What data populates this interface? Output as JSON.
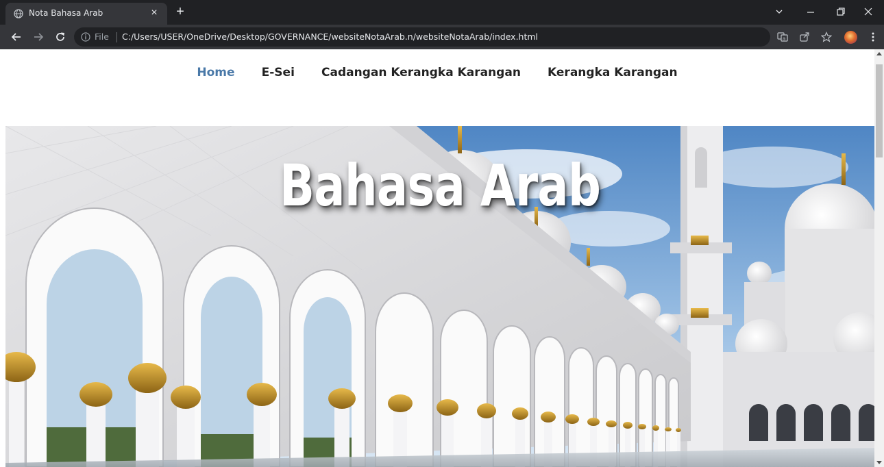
{
  "browser": {
    "tab_title": "Nota Bahasa Arab",
    "new_tab_symbol": "+",
    "close_symbol": "×",
    "file_label": "File",
    "url": "C:/Users/USER/OneDrive/Desktop/GOVERNANCE/websiteNotaArab.n/websiteNotaArab/index.html"
  },
  "nav": {
    "items": [
      {
        "label": "Home",
        "active": true
      },
      {
        "label": "E-Sei",
        "active": false
      },
      {
        "label": "Cadangan Kerangka Karangan",
        "active": false
      },
      {
        "label": "Kerangka Karangan",
        "active": false
      }
    ],
    "active_color": "#4a79a8",
    "text_color": "#222222"
  },
  "hero": {
    "title": "Bahasa Arab"
  }
}
